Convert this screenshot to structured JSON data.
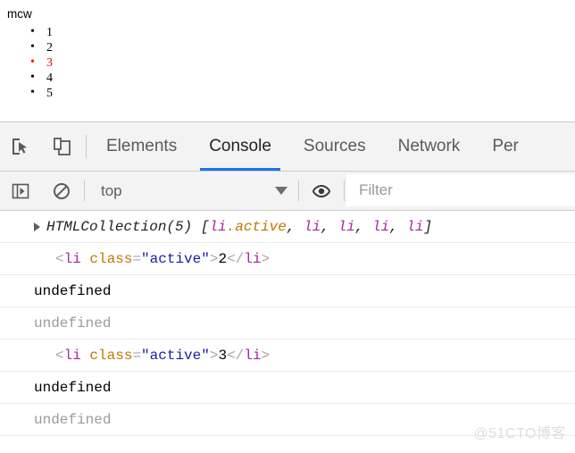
{
  "page": {
    "heading": "mcw",
    "list_items": [
      {
        "text": "1",
        "active": false
      },
      {
        "text": "2",
        "active": false
      },
      {
        "text": "3",
        "active": true
      },
      {
        "text": "4",
        "active": false
      },
      {
        "text": "5",
        "active": false
      }
    ],
    "active_color": "#ff0000",
    "text_color": "#000000"
  },
  "devtools": {
    "toolbar": {
      "inspect_icon": "inspect-element-icon",
      "device_icon": "device-toolbar-icon",
      "tabs": [
        {
          "label": "Elements",
          "selected": false
        },
        {
          "label": "Console",
          "selected": true
        },
        {
          "label": "Sources",
          "selected": false
        },
        {
          "label": "Network",
          "selected": false
        },
        {
          "label": "Per",
          "selected": false
        }
      ],
      "selected_tab_underline_color": "#1a73e8"
    },
    "console_bar": {
      "sidebar_icon": "console-sidebar-icon",
      "clear_icon": "clear-console-icon",
      "context_value": "top",
      "context_caret_icon": "chevron-down-icon",
      "eye_icon": "live-expression-eye-icon",
      "filter_placeholder": "Filter",
      "filter_value": ""
    },
    "messages": [
      {
        "kind": "object",
        "expandable": true,
        "disclosure_icon": "disclosure-triangle-icon",
        "tokens": [
          {
            "text": "HTMLCollection(5)",
            "color": "#222222"
          },
          {
            "text": " [",
            "color": "#222222"
          },
          {
            "text": "li",
            "color": "#a626a4"
          },
          {
            "text": ".active",
            "color": "#c07800"
          },
          {
            "text": ", ",
            "color": "#222222"
          },
          {
            "text": "li",
            "color": "#a626a4"
          },
          {
            "text": ", ",
            "color": "#222222"
          },
          {
            "text": "li",
            "color": "#a626a4"
          },
          {
            "text": ", ",
            "color": "#222222"
          },
          {
            "text": "li",
            "color": "#a626a4"
          },
          {
            "text": ", ",
            "color": "#222222"
          },
          {
            "text": "li",
            "color": "#a626a4"
          },
          {
            "text": "]",
            "color": "#222222"
          }
        ],
        "plain": "HTMLCollection(5) [li.active, li, li, li, li]"
      },
      {
        "kind": "dom",
        "expandable": false,
        "tokens": [
          {
            "text": "<",
            "color": "#b0a0b0"
          },
          {
            "text": "li",
            "color": "#a626a4"
          },
          {
            "text": " ",
            "color": "#b0a0b0"
          },
          {
            "text": "class",
            "color": "#c07800"
          },
          {
            "text": "=",
            "color": "#b0a0b0"
          },
          {
            "text": "\"active\"",
            "color": "#1a1aa6"
          },
          {
            "text": ">",
            "color": "#b0a0b0"
          },
          {
            "text": "2",
            "color": "#000000"
          },
          {
            "text": "</",
            "color": "#b0a0b0"
          },
          {
            "text": "li",
            "color": "#a626a4"
          },
          {
            "text": ">",
            "color": "#b0a0b0"
          }
        ],
        "plain": "<li class=\"active\">2</li>"
      },
      {
        "kind": "undefined",
        "muted": false,
        "plain": "undefined"
      },
      {
        "kind": "undefined",
        "muted": true,
        "plain": "undefined"
      },
      {
        "kind": "dom",
        "expandable": false,
        "tokens": [
          {
            "text": "<",
            "color": "#b0a0b0"
          },
          {
            "text": "li",
            "color": "#a626a4"
          },
          {
            "text": " ",
            "color": "#b0a0b0"
          },
          {
            "text": "class",
            "color": "#c07800"
          },
          {
            "text": "=",
            "color": "#b0a0b0"
          },
          {
            "text": "\"active\"",
            "color": "#1a1aa6"
          },
          {
            "text": ">",
            "color": "#b0a0b0"
          },
          {
            "text": "3",
            "color": "#000000"
          },
          {
            "text": "</",
            "color": "#b0a0b0"
          },
          {
            "text": "li",
            "color": "#a626a4"
          },
          {
            "text": ">",
            "color": "#b0a0b0"
          }
        ],
        "plain": "<li class=\"active\">3</li>"
      },
      {
        "kind": "undefined",
        "muted": false,
        "plain": "undefined"
      },
      {
        "kind": "undefined",
        "muted": true,
        "plain": "undefined"
      }
    ],
    "watermark": "@51CTO博客"
  }
}
